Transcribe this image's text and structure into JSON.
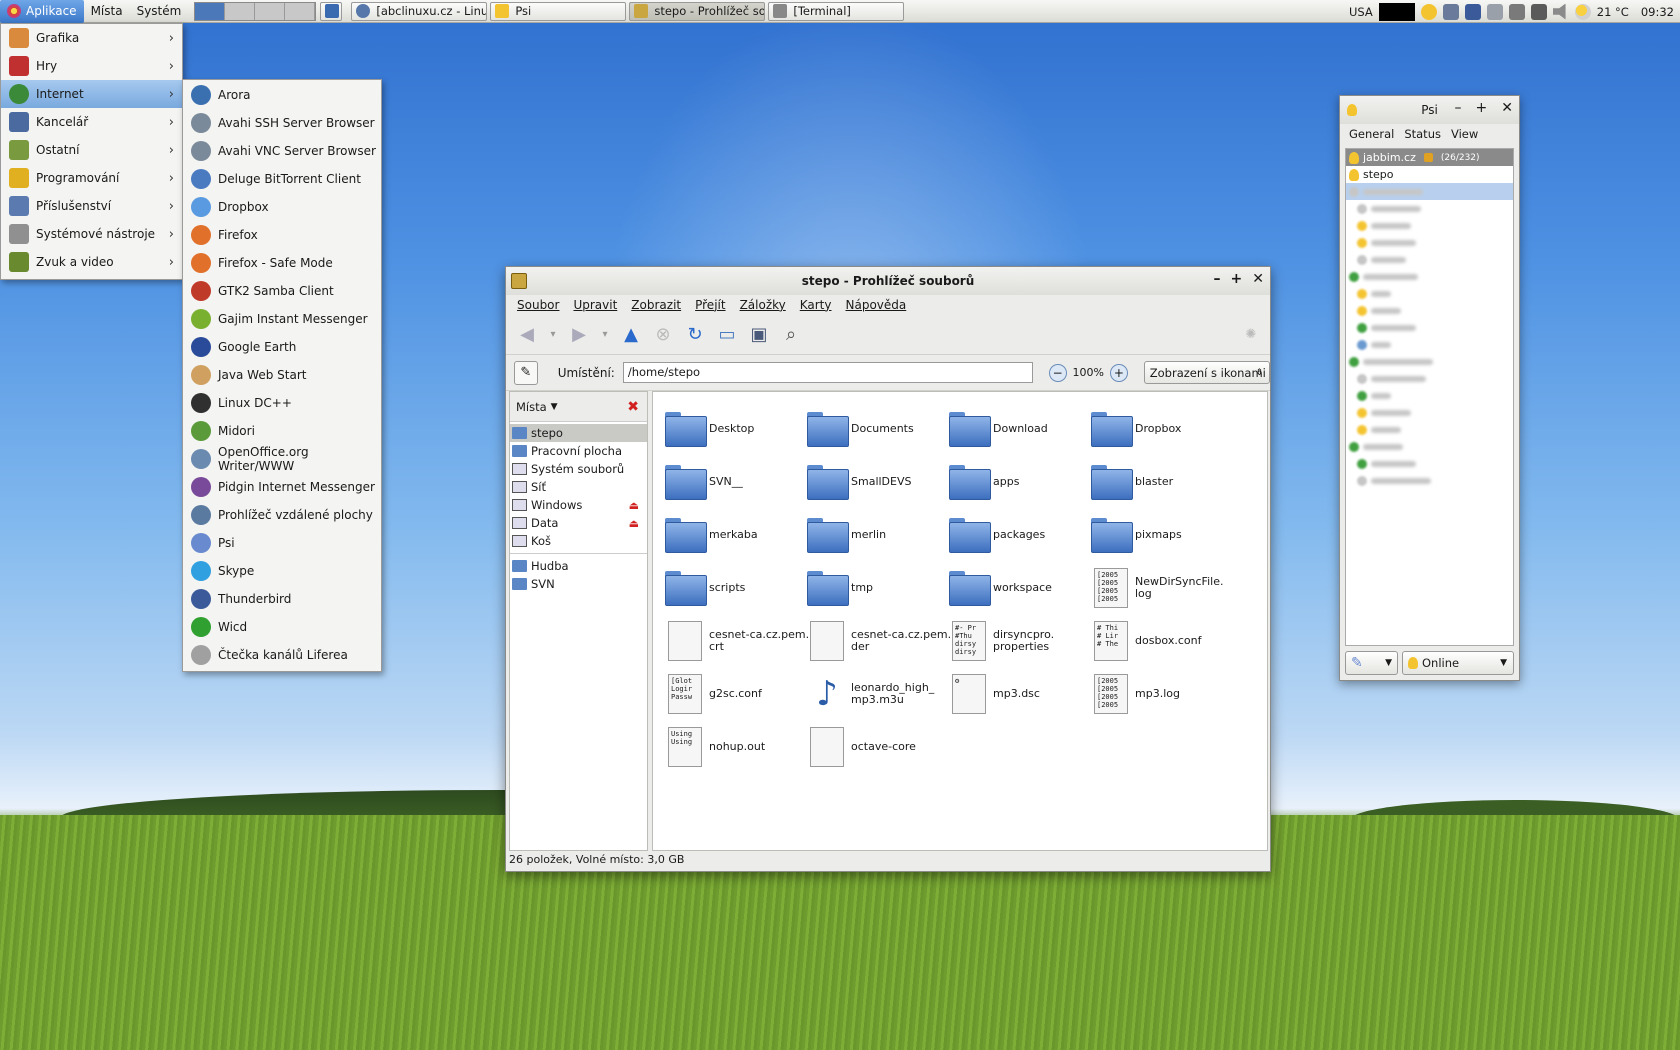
{
  "panel": {
    "menus": [
      "Aplikace",
      "Místa",
      "Systém"
    ],
    "tasks": [
      {
        "label": "[abclinuxu.cz - Linux ...",
        "icon": "globe-icon",
        "color": "#5577aa"
      },
      {
        "label": "Psi",
        "icon": "lightbulb-icon",
        "color": "#f4c430"
      },
      {
        "label": "stepo - Prohlížeč sou...",
        "icon": "filemanager-icon",
        "color": "#c9a640"
      },
      {
        "label": "[Terminal]",
        "icon": "terminal-icon",
        "color": "#888888"
      }
    ],
    "keyboard": "USA",
    "weather": "21 °C",
    "clock": "09:32"
  },
  "apps_menu": {
    "items": [
      {
        "label": "Grafika",
        "icon": "graphics-icon",
        "color": "#d98a3c"
      },
      {
        "label": "Hry",
        "icon": "games-icon",
        "color": "#c03030"
      },
      {
        "label": "Internet",
        "icon": "globe-icon",
        "color": "#3a8a3a"
      },
      {
        "label": "Kancelář",
        "icon": "office-icon",
        "color": "#4a6aa0"
      },
      {
        "label": "Ostatní",
        "icon": "other-icon",
        "color": "#7a9a40"
      },
      {
        "label": "Programování",
        "icon": "programming-icon",
        "color": "#e0b020"
      },
      {
        "label": "Příslušenství",
        "icon": "accessories-icon",
        "color": "#5a7ab0"
      },
      {
        "label": "Systémové nástroje",
        "icon": "system-tools-icon",
        "color": "#909090"
      },
      {
        "label": "Zvuk a video",
        "icon": "multimedia-icon",
        "color": "#6a8a30"
      }
    ]
  },
  "internet_menu": {
    "items": [
      {
        "label": "Arora",
        "icon": "arora-icon",
        "color": "#3a70b0"
      },
      {
        "label": "Avahi SSH Server Browser",
        "icon": "avahi-icon",
        "color": "#7a8a9a"
      },
      {
        "label": "Avahi VNC Server Browser",
        "icon": "avahi-icon",
        "color": "#7a8a9a"
      },
      {
        "label": "Deluge BitTorrent Client",
        "icon": "deluge-icon",
        "color": "#4a7ac0"
      },
      {
        "label": "Dropbox",
        "icon": "dropbox-icon",
        "color": "#5a9ae0"
      },
      {
        "label": "Firefox",
        "icon": "firefox-icon",
        "color": "#e0702a"
      },
      {
        "label": "Firefox - Safe Mode",
        "icon": "firefox-icon",
        "color": "#e0702a"
      },
      {
        "label": "GTK2 Samba Client",
        "icon": "samba-icon",
        "color": "#c03a2a"
      },
      {
        "label": "Gajim Instant Messenger",
        "icon": "gajim-icon",
        "color": "#7ab030"
      },
      {
        "label": "Google Earth",
        "icon": "google-earth-icon",
        "color": "#2a4a9a"
      },
      {
        "label": "Java Web Start",
        "icon": "java-icon",
        "color": "#d0a060"
      },
      {
        "label": "Linux DC++",
        "icon": "tux-icon",
        "color": "#303030"
      },
      {
        "label": "Midori",
        "icon": "midori-icon",
        "color": "#5a9a3a"
      },
      {
        "label": "OpenOffice.org Writer/WWW",
        "icon": "openoffice-icon",
        "color": "#6a8ab0"
      },
      {
        "label": "Pidgin Internet Messenger",
        "icon": "pidgin-icon",
        "color": "#7a4a9a"
      },
      {
        "label": "Prohlížeč vzdálené plochy",
        "icon": "remote-desktop-icon",
        "color": "#5a7aa0"
      },
      {
        "label": "Psi",
        "icon": "psi-icon",
        "color": "#6a8ad0"
      },
      {
        "label": "Skype",
        "icon": "skype-icon",
        "color": "#30a0e0"
      },
      {
        "label": "Thunderbird",
        "icon": "thunderbird-icon",
        "color": "#3a5a9a"
      },
      {
        "label": "Wicd",
        "icon": "wicd-icon",
        "color": "#30a030"
      },
      {
        "label": "Čtečka kanálů Liferea",
        "icon": "liferea-icon",
        "color": "#a0a0a0"
      }
    ]
  },
  "file_manager": {
    "title": "stepo - Prohlížeč souborů",
    "menubar": [
      "Soubor",
      "Upravit",
      "Zobrazit",
      "Přejít",
      "Záložky",
      "Karty",
      "Nápověda"
    ],
    "location_label": "Umístění:",
    "location_value": "/home/stepo",
    "zoom": "100%",
    "view_mode": "Zobrazení s ikonami",
    "sidebar_title": "Místa",
    "places": [
      {
        "label": "stepo",
        "kind": "folder",
        "eject": false
      },
      {
        "label": "Pracovní plocha",
        "kind": "folder",
        "eject": false
      },
      {
        "label": "Systém souborů",
        "kind": "drive",
        "eject": false
      },
      {
        "label": "Síť",
        "kind": "drive",
        "eject": false
      },
      {
        "label": "Windows",
        "kind": "drive",
        "eject": true
      },
      {
        "label": "Data",
        "kind": "drive",
        "eject": true
      },
      {
        "label": "Koš",
        "kind": "trash",
        "eject": false
      }
    ],
    "bookmarks": [
      {
        "label": "Hudba"
      },
      {
        "label": "SVN"
      }
    ],
    "files": [
      {
        "name": "Desktop",
        "type": "folder",
        "preview": ""
      },
      {
        "name": "Documents",
        "type": "folder",
        "preview": ""
      },
      {
        "name": "Download",
        "type": "folder",
        "preview": ""
      },
      {
        "name": "Dropbox",
        "type": "folder",
        "preview": ""
      },
      {
        "name": "SVN__",
        "type": "folder",
        "preview": ""
      },
      {
        "name": "SmallDEVS",
        "type": "folder",
        "preview": ""
      },
      {
        "name": "apps",
        "type": "folder",
        "preview": ""
      },
      {
        "name": "blaster",
        "type": "folder",
        "preview": ""
      },
      {
        "name": "merkaba",
        "type": "folder",
        "preview": ""
      },
      {
        "name": "merlin",
        "type": "folder",
        "preview": ""
      },
      {
        "name": "packages",
        "type": "folder",
        "preview": ""
      },
      {
        "name": "pixmaps",
        "type": "folder",
        "preview": ""
      },
      {
        "name": "scripts",
        "type": "folder",
        "preview": ""
      },
      {
        "name": "tmp",
        "type": "folder",
        "preview": ""
      },
      {
        "name": "workspace",
        "type": "folder",
        "preview": ""
      },
      {
        "name": "NewDirSyncFile.\nlog",
        "type": "doc",
        "preview": "[2005\n[2005\n[2005\n[2005"
      },
      {
        "name": "cesnet-ca.cz.pem.\ncrt",
        "type": "doc",
        "preview": ""
      },
      {
        "name": "cesnet-ca.cz.pem.\nder",
        "type": "doc",
        "preview": ""
      },
      {
        "name": "dirsyncpro.\nproperties",
        "type": "doc",
        "preview": "#- Pr\n#Thu\ndirsy\ndirsy"
      },
      {
        "name": "dosbox.conf",
        "type": "doc",
        "preview": "# Thi\n# Lir\n# The"
      },
      {
        "name": "g2sc.conf",
        "type": "doc",
        "preview": "[Glot\nLogir\nPassw"
      },
      {
        "name": "leonardo_high_\nmp3.m3u",
        "type": "audio",
        "preview": ""
      },
      {
        "name": "mp3.dsc",
        "type": "doc",
        "preview": "⚙"
      },
      {
        "name": "mp3.log",
        "type": "doc",
        "preview": "[2005\n[2005\n[2005\n[2005"
      },
      {
        "name": "nohup.out",
        "type": "doc",
        "preview": "Using\nUsing"
      },
      {
        "name": "octave-core",
        "type": "doc",
        "preview": ""
      }
    ],
    "status": "26 položek, Volné místo: 3,0 GB"
  },
  "psi": {
    "title": "Psi",
    "menu": [
      "General",
      "Status",
      "View"
    ],
    "account": "jabbim.cz",
    "account_count": "(26/232)",
    "contact": "stepo",
    "status": "Online"
  }
}
